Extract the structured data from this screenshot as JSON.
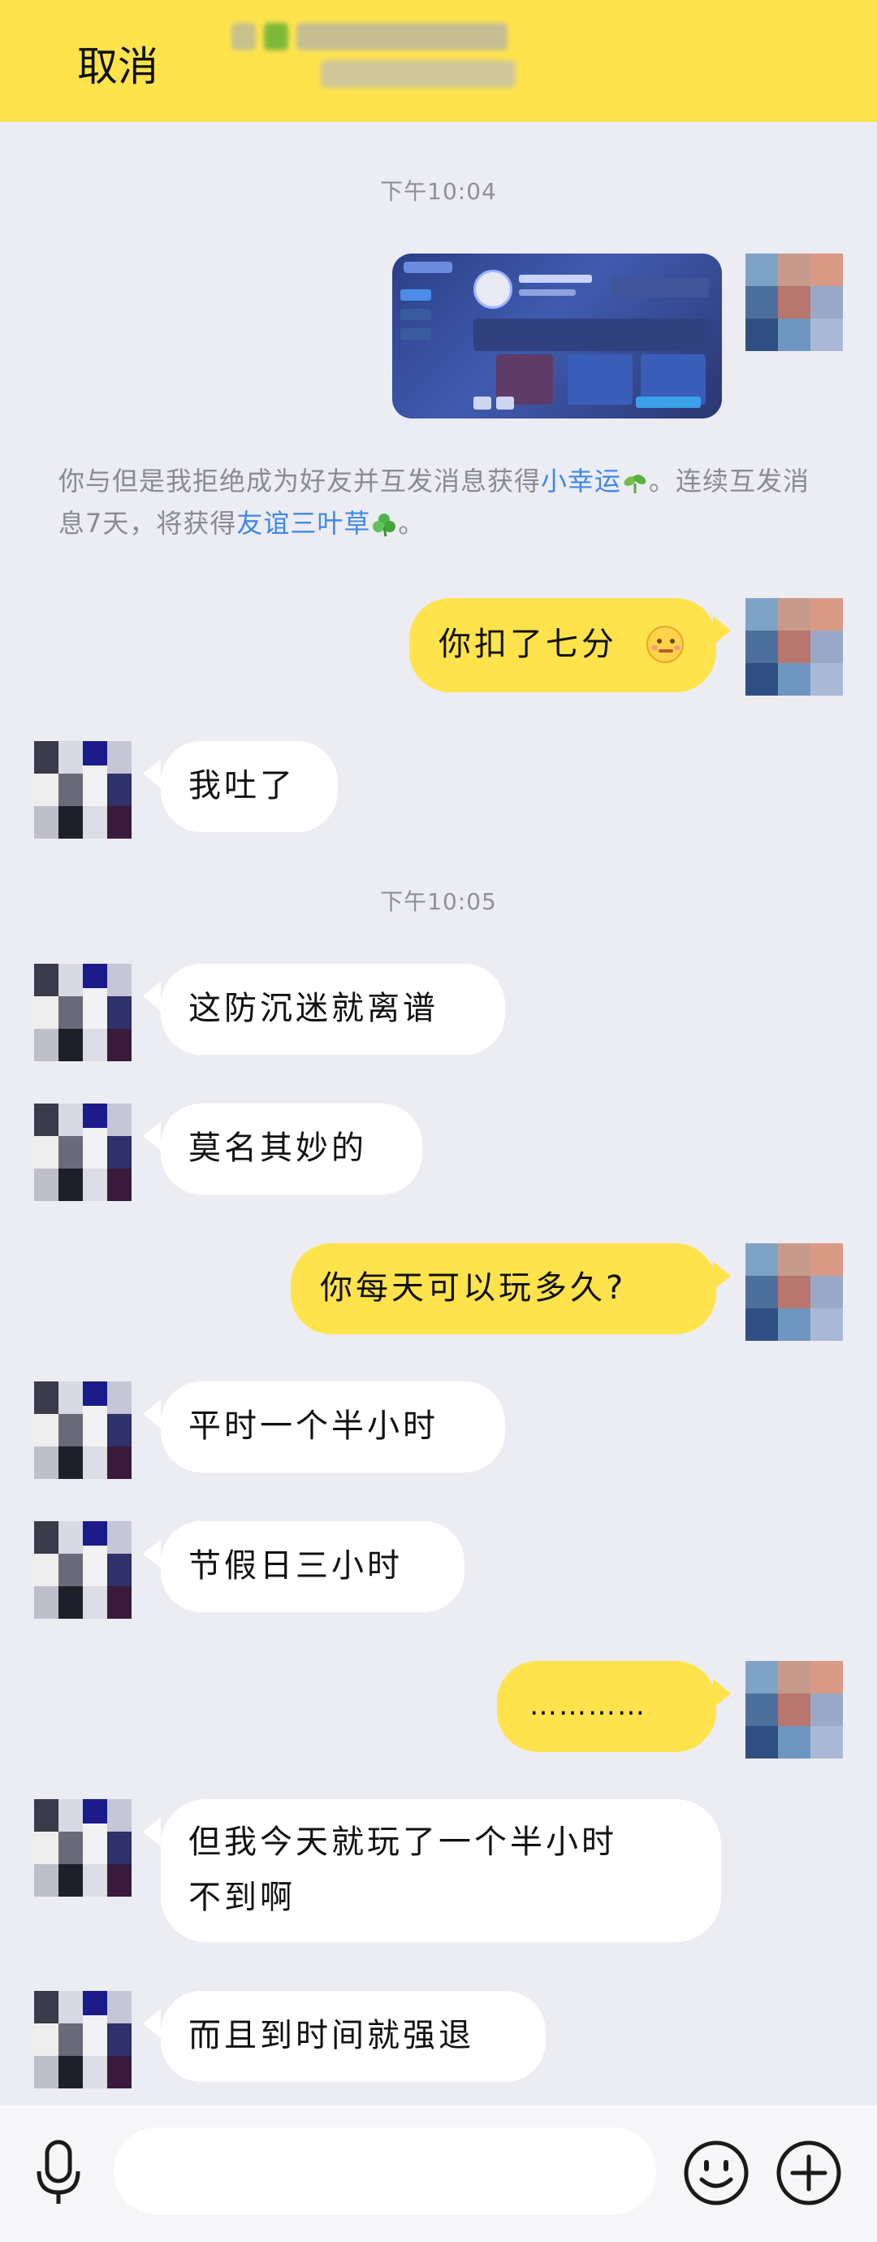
{
  "header": {
    "cancel_label": "取消"
  },
  "timestamps": [
    "下午10:04",
    "下午10:05"
  ],
  "system_message": {
    "text_a": "你与但是我拒绝成为好友并互发消息获得",
    "link_a": "小幸运",
    "text_b": "。连续互发消息7天，将获得",
    "link_b": "友谊三叶草",
    "text_c": "。"
  },
  "messages": [
    {
      "side": "right",
      "text": "你扣了七分"
    },
    {
      "side": "left",
      "text": "我吐了"
    },
    {
      "side": "left",
      "text": "这防沉迷就离谱"
    },
    {
      "side": "left",
      "text": "莫名其妙的"
    },
    {
      "side": "right",
      "text": "你每天可以玩多久?"
    },
    {
      "side": "left",
      "text": "平时一个半小时"
    },
    {
      "side": "left",
      "text": "节假日三小时"
    },
    {
      "side": "right",
      "text": "…………"
    },
    {
      "side": "left",
      "text_line1": "但我今天就玩了一个半小时",
      "text_line2": "不到啊"
    },
    {
      "side": "left",
      "text": "而且到时间就强退"
    }
  ],
  "icons": {
    "voice": "microphone-icon",
    "emoji": "smiley-icon",
    "more": "plus-icon",
    "sprout": "sprout-icon",
    "clover": "clover-icon"
  },
  "colors": {
    "accent": "#ffe34d",
    "background": "#ececf3",
    "link": "#3f88e8",
    "timestamp": "#8f8f9c"
  }
}
